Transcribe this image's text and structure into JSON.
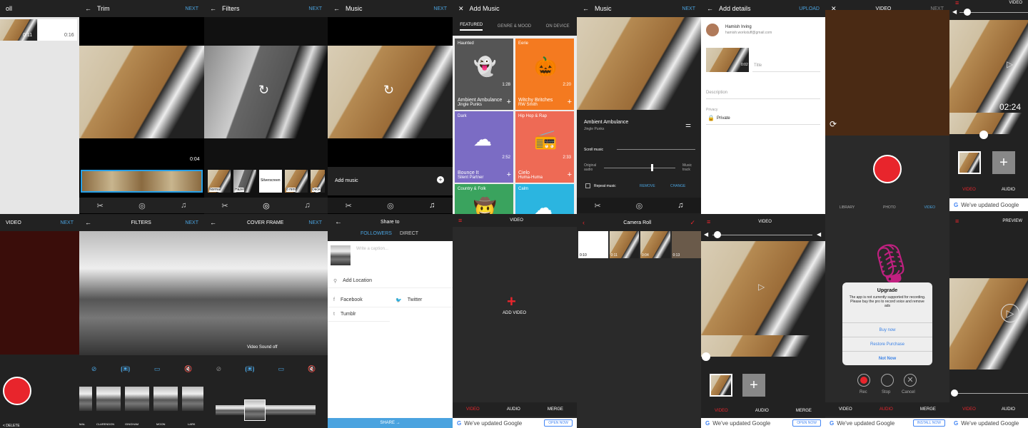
{
  "p1": {
    "title": "oll",
    "t1": "0:11",
    "t2": "0:16"
  },
  "trim": {
    "title": "Trim",
    "next": "NEXT",
    "time": "0:04"
  },
  "filters1": {
    "title": "Filters",
    "next": "NEXT",
    "items": [
      "Normal",
      "Hazel",
      "Silverscreen",
      "8 mm",
      "Dece"
    ]
  },
  "music1": {
    "title": "Music",
    "next": "NEXT",
    "add": "Add music"
  },
  "addmusic": {
    "title": "Add Music",
    "tabs": [
      "FEATURED",
      "GENRE & MOOD",
      "ON DEVICE"
    ],
    "cards": [
      {
        "tag": "Haunted",
        "name": "Ambient Ambulance",
        "artist": "Jingle Punks",
        "dur": "1:28",
        "color": "#555555",
        "icon": "ghost-icon"
      },
      {
        "tag": "Eerie",
        "name": "Witchy Britches",
        "artist": "RW Smith",
        "dur": "2:20",
        "color": "#f47a20",
        "icon": "pumpkin-icon"
      },
      {
        "tag": "Dark",
        "name": "Bounce It",
        "artist": "Silent Partner",
        "dur": "2:52",
        "color": "#7b6cc4",
        "icon": "cloud-rain-icon"
      },
      {
        "tag": "Hip Hop & Rap",
        "name": "Cielo",
        "artist": "Huma-Huma",
        "dur": "2:33",
        "color": "#ee6a55",
        "icon": "boombox-icon"
      },
      {
        "tag": "Country & Folk",
        "name": "",
        "artist": "",
        "dur": "",
        "color": "#3aa35e",
        "icon": "hat-icon"
      },
      {
        "tag": "Calm",
        "name": "",
        "artist": "",
        "dur": "",
        "color": "#2bb5e0",
        "icon": "cloud-icon"
      }
    ]
  },
  "music2": {
    "title": "Music",
    "next": "NEXT",
    "track": "Ambient Ambulance",
    "artist": "Jingle Punks",
    "scroll": "Scroll music",
    "orig": "Original audio",
    "mtrack": "Music track",
    "repeat": "Repeat music",
    "remove": "REMOVE",
    "change": "CHANGE"
  },
  "details": {
    "title": "Add details",
    "upload": "UPLOAD",
    "user": "Hamish Irving",
    "email": "hamish.workstuff@gmail.com",
    "dur": "0:02",
    "title_ph": "Title",
    "desc": "Description",
    "privacy_l": "Privacy",
    "privacy": "Private"
  },
  "video1": {
    "title": "VIDEO",
    "next": "NEXT",
    "tabs": [
      "LIBRARY",
      "PHOTO",
      "VIDEO"
    ]
  },
  "video2": {
    "title": "VIDEO",
    "time": "02:24",
    "tabs": [
      "VIDEO",
      "AUDIO"
    ],
    "gbar": "We've updated Google"
  },
  "videoB1": {
    "title": "VIDEO",
    "next": "NEXT",
    "delete": "< DELETE"
  },
  "filters2": {
    "title": "FILTERS",
    "next": "NEXT",
    "items": [
      "MAL",
      "CLARENDON",
      "GINGHAM",
      "MOON",
      "LARK"
    ]
  },
  "cover": {
    "title": "COVER FRAME",
    "next": "NEXT",
    "sound": "Video Sound off"
  },
  "share": {
    "title": "Share to",
    "tabs": [
      "FOLLOWERS",
      "DIRECT"
    ],
    "caption": "Write a caption...",
    "location": "Add Location",
    "facebook": "Facebook",
    "twitter": "Twitter",
    "tumblr": "Tumblr",
    "share": "SHARE →"
  },
  "addvideo": {
    "title": "VIDEO",
    "add": "ADD VIDEO",
    "tabs": [
      "VIDEO",
      "AUDIO",
      "MERGE"
    ],
    "gbar": "We've updated Google",
    "install": "OPEN NOW"
  },
  "roll": {
    "title": "Camera Roll",
    "times": [
      "0:10",
      "0:11",
      "0:04",
      "0:13"
    ]
  },
  "video3": {
    "title": "VIDEO",
    "tabs": [
      "VIDEO",
      "AUDIO",
      "MERGE"
    ],
    "gbar": "We've updated Google",
    "install": "OPEN NOW"
  },
  "upgrade": {
    "title": "Upgrade",
    "msg": "The app is not currently supported for recording. Please buy the pro to record voice and remove ads",
    "buy": "Buy now",
    "restore": "Restore Purchase",
    "not": "Not Now",
    "rec": "Rec",
    "stop": "Stop",
    "cancel": "Cancel",
    "tabs": [
      "VIDEO",
      "AUDIO",
      "MERGE"
    ],
    "gbar": "We've updated Google",
    "install": "INSTALL NOW"
  },
  "preview": {
    "title": "PREVIEW",
    "tabs": [
      "VIDEO",
      "AUDIO"
    ],
    "gbar": "We've updated Google"
  }
}
